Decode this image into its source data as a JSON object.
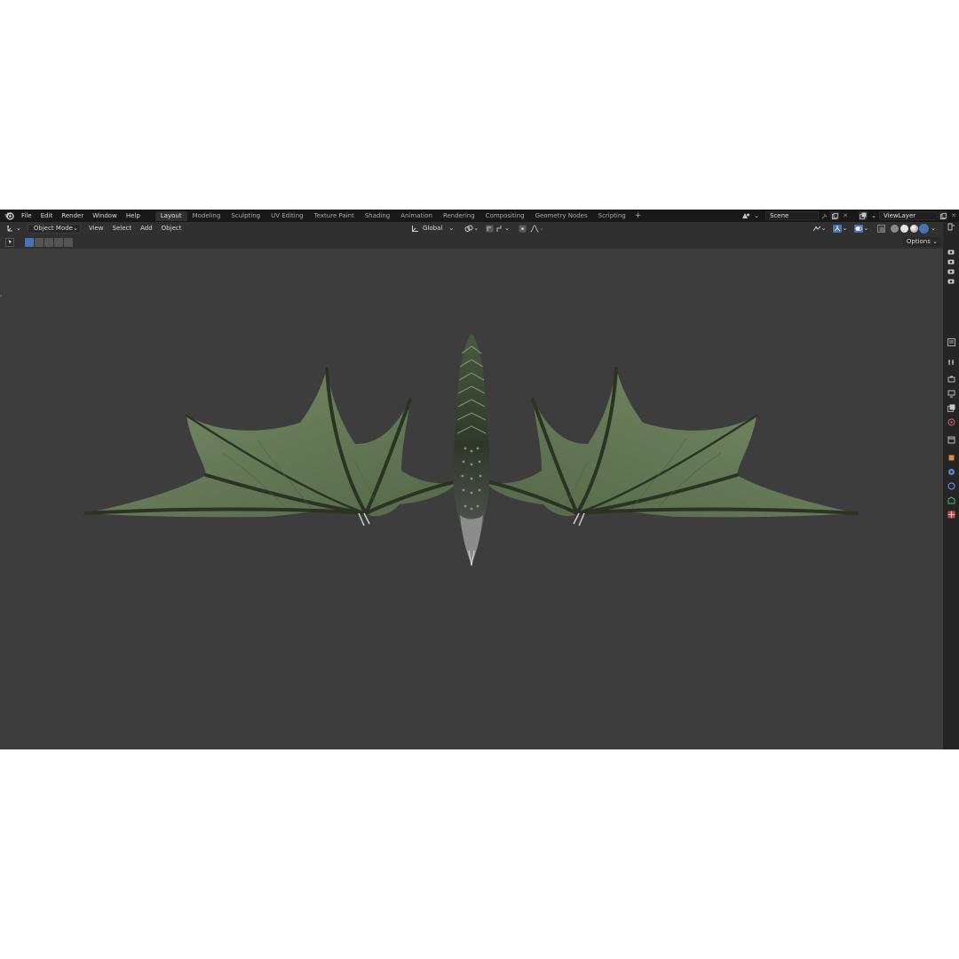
{
  "topbar": {
    "menus": [
      "File",
      "Edit",
      "Render",
      "Window",
      "Help"
    ],
    "workspaces": [
      "Layout",
      "Modeling",
      "Sculpting",
      "UV Editing",
      "Texture Paint",
      "Shading",
      "Animation",
      "Rendering",
      "Compositing",
      "Geometry Nodes",
      "Scripting"
    ],
    "active_workspace": "Layout",
    "add_workspace": "+",
    "scene_name": "Scene",
    "view_layer": "ViewLayer"
  },
  "header": {
    "mode": "Object Mode",
    "menus": [
      "View",
      "Select",
      "Add",
      "Object"
    ],
    "transform_orientation": "Global"
  },
  "toolrow": {
    "options_label": "Options"
  },
  "icons": {
    "blender": "blender-logo-icon",
    "editor_type": "3d-viewport-icon",
    "mode": "object-mode-icon",
    "orientation": "transform-orientation-icon",
    "pivot": "pivot-point-icon",
    "snap": "snap-icon",
    "proportional": "proportional-editing-icon",
    "visibility": "visibility-icon",
    "gizmo": "gizmo-icon",
    "overlay": "overlay-icon",
    "xray": "xray-icon",
    "select_box": "select-box-icon"
  },
  "colors": {
    "accent": "#4772b3",
    "viewport_bg": "#3d3d3d",
    "dragon_wing": "#6a7d5c",
    "dragon_body": "#2b3327"
  }
}
